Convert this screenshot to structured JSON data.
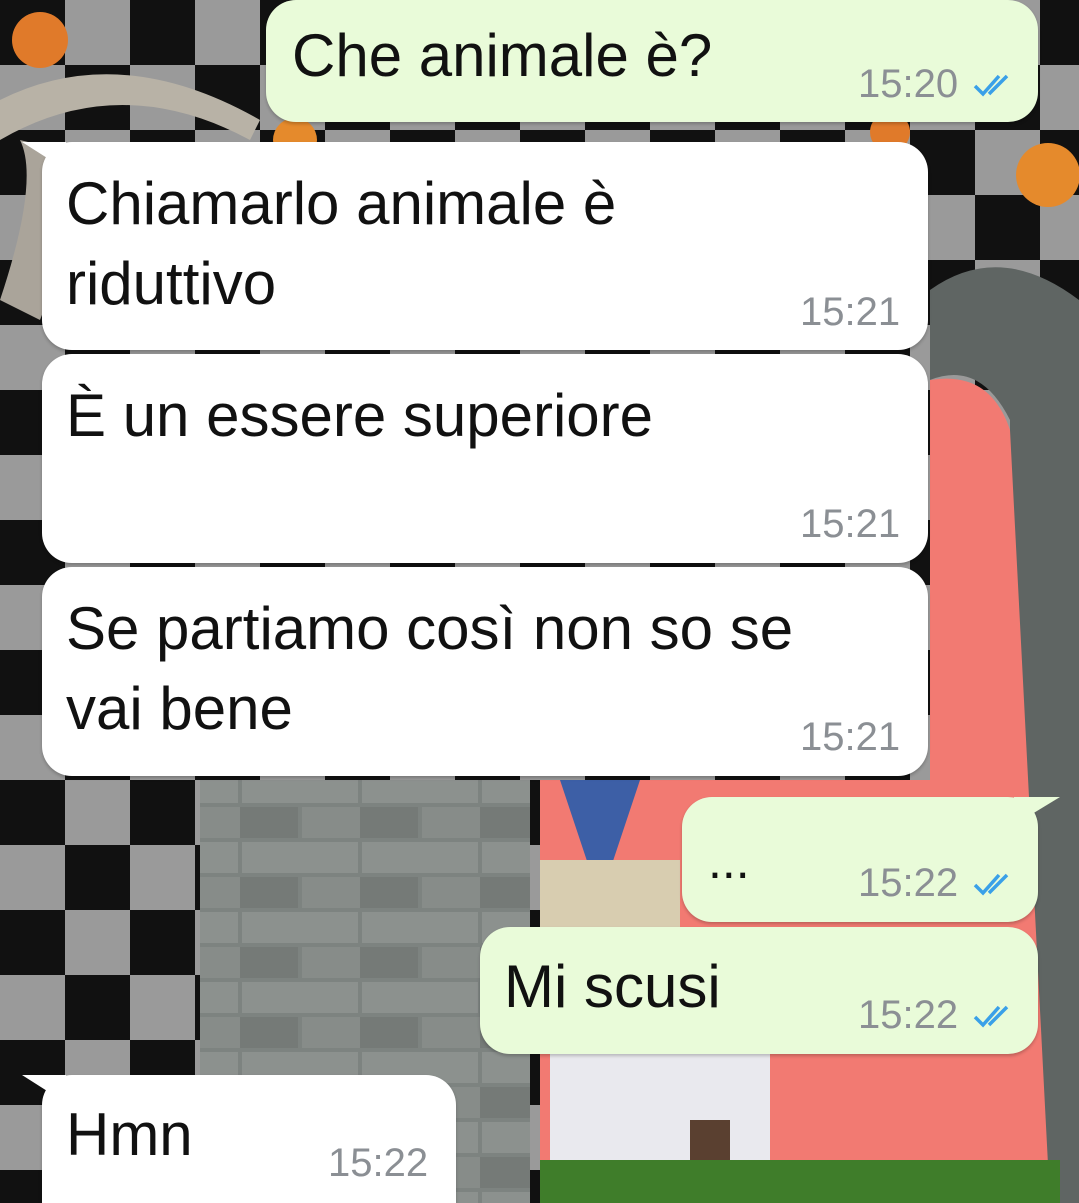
{
  "colors": {
    "incoming_bubble": "#ffffff",
    "outgoing_bubble": "#e9fbd9",
    "timestamp": "#8b8f94",
    "read_ticks": "#3aa0e8"
  },
  "icons": {
    "read_receipt": "double-check-icon"
  },
  "messages": [
    {
      "direction": "outgoing",
      "text": "Che animale è?",
      "time": "15:20",
      "status": "read"
    },
    {
      "direction": "incoming",
      "lines": [
        "Chiamarlo animale è",
        "riduttivo"
      ],
      "time": "15:21"
    },
    {
      "direction": "incoming",
      "text": "È un essere superiore",
      "time": "15:21"
    },
    {
      "direction": "incoming",
      "lines": [
        "Se partiamo così non so se",
        "vai bene"
      ],
      "time": "15:21"
    },
    {
      "direction": "outgoing",
      "text": "...",
      "time": "15:22",
      "status": "read"
    },
    {
      "direction": "outgoing",
      "text": "Mi scusi",
      "time": "15:22",
      "status": "read"
    },
    {
      "direction": "incoming",
      "text": "Hmn",
      "time": "15:22"
    }
  ]
}
